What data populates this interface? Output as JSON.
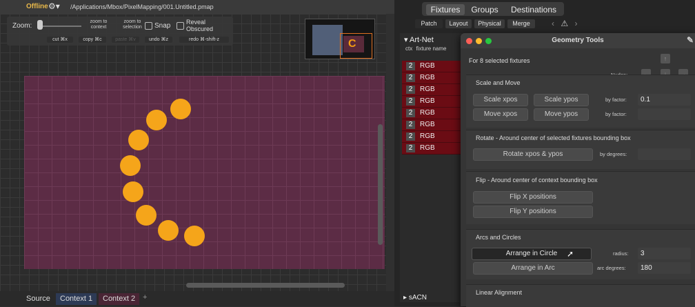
{
  "titlebar": {
    "status": "Offline",
    "path": "/Applications/Mbox/PixelMapping/001.Untitled.pmap"
  },
  "toolbar": {
    "zoom_label": "Zoom:",
    "zoom_to_context": "zoom to context",
    "zoom_to_selection": "zoom to selection",
    "snap_label": "Snap",
    "reveal_label": "Reveal Obscured",
    "cut": "cut ⌘x",
    "copy": "copy ⌘c",
    "paste": "paste ⌘v",
    "undo": "undo ⌘z",
    "redo": "redo ⌘-shift-z"
  },
  "canvas": {
    "minimap_glyph": "C",
    "fixture_color": "#f5a51a",
    "grid_color": "#5c2c45"
  },
  "context_tabs": [
    "Source",
    "Context 1",
    "Context 2"
  ],
  "top_tabs": [
    "Fixtures",
    "Groups",
    "Destinations"
  ],
  "sub_tabs": [
    "Patch",
    "Layout",
    "Physical",
    "Merge"
  ],
  "artnet": {
    "header": "Art-Net",
    "col_ctx": "ctx",
    "col_name": "fixture name",
    "rows": [
      {
        "ctx": "2",
        "name": "RGB"
      },
      {
        "ctx": "2",
        "name": "RGB"
      },
      {
        "ctx": "2",
        "name": "RGB"
      },
      {
        "ctx": "2",
        "name": "RGB"
      },
      {
        "ctx": "2",
        "name": "RGB"
      },
      {
        "ctx": "2",
        "name": "RGB"
      },
      {
        "ctx": "2",
        "name": "RGB"
      },
      {
        "ctx": "2",
        "name": "RGB"
      }
    ],
    "sacn": "sACN"
  },
  "geometry": {
    "title": "Geometry Tools",
    "selected": "For 8 selected fixtures",
    "nudge": "Nudge:",
    "scale_move": {
      "heading": "Scale and Move",
      "scale_x": "Scale xpos",
      "scale_y": "Scale ypos",
      "move_x": "Move xpos",
      "move_y": "Move ypos",
      "by_factor": "by factor:",
      "factor_value": "0.1"
    },
    "rotate": {
      "heading": "Rotate - Around center of selected fixtures bounding box",
      "button": "Rotate xpos & ypos",
      "by_degrees": "by degrees:"
    },
    "flip": {
      "heading": "Flip - Around center of context bounding box",
      "flip_x": "Flip X positions",
      "flip_y": "Flip Y positions"
    },
    "arcs": {
      "heading": "Arcs and Circles",
      "circle": "Arrange in Circle",
      "arc": "Arrange in Arc",
      "radius_label": "radius:",
      "radius_value": "3",
      "arc_degrees_label": "arc degrees:",
      "arc_degrees_value": "180"
    },
    "linear": {
      "heading": "Linear Alignment"
    }
  }
}
